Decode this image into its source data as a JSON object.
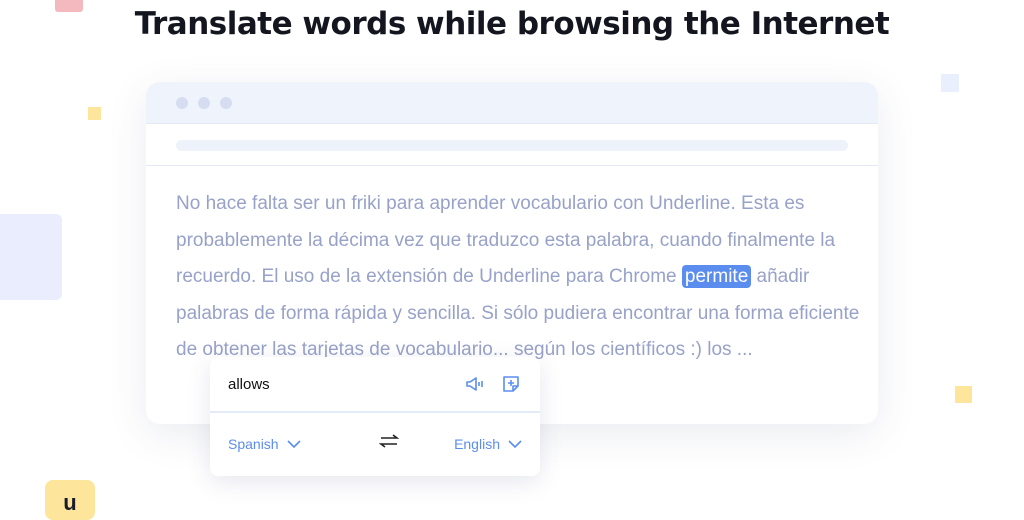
{
  "headline": "Translate words while browsing the Internet",
  "logo_letter": "u",
  "paragraph": {
    "before": "No hace falta ser un friki para aprender vocabulario con Underline. Esta es probablemente la décima vez que traduzco esta palabra, cuando finalmente la recuerdo. El uso de la extensión de Underline para Chrome ",
    "highlight": "permite",
    "after": " añadir palabras de forma rápida y sencilla. Si sólo pudiera encontrar una forma eficiente de obtener las tarjetas de vocabulario... según los científicos :) los ..."
  },
  "popup": {
    "translation": "allows",
    "source_lang": "Spanish",
    "target_lang": "English",
    "icons": [
      "speaker-icon",
      "add-note-icon",
      "swap-icon"
    ]
  },
  "colors": {
    "accent": "#5b8def",
    "text": "#98a2c8"
  }
}
